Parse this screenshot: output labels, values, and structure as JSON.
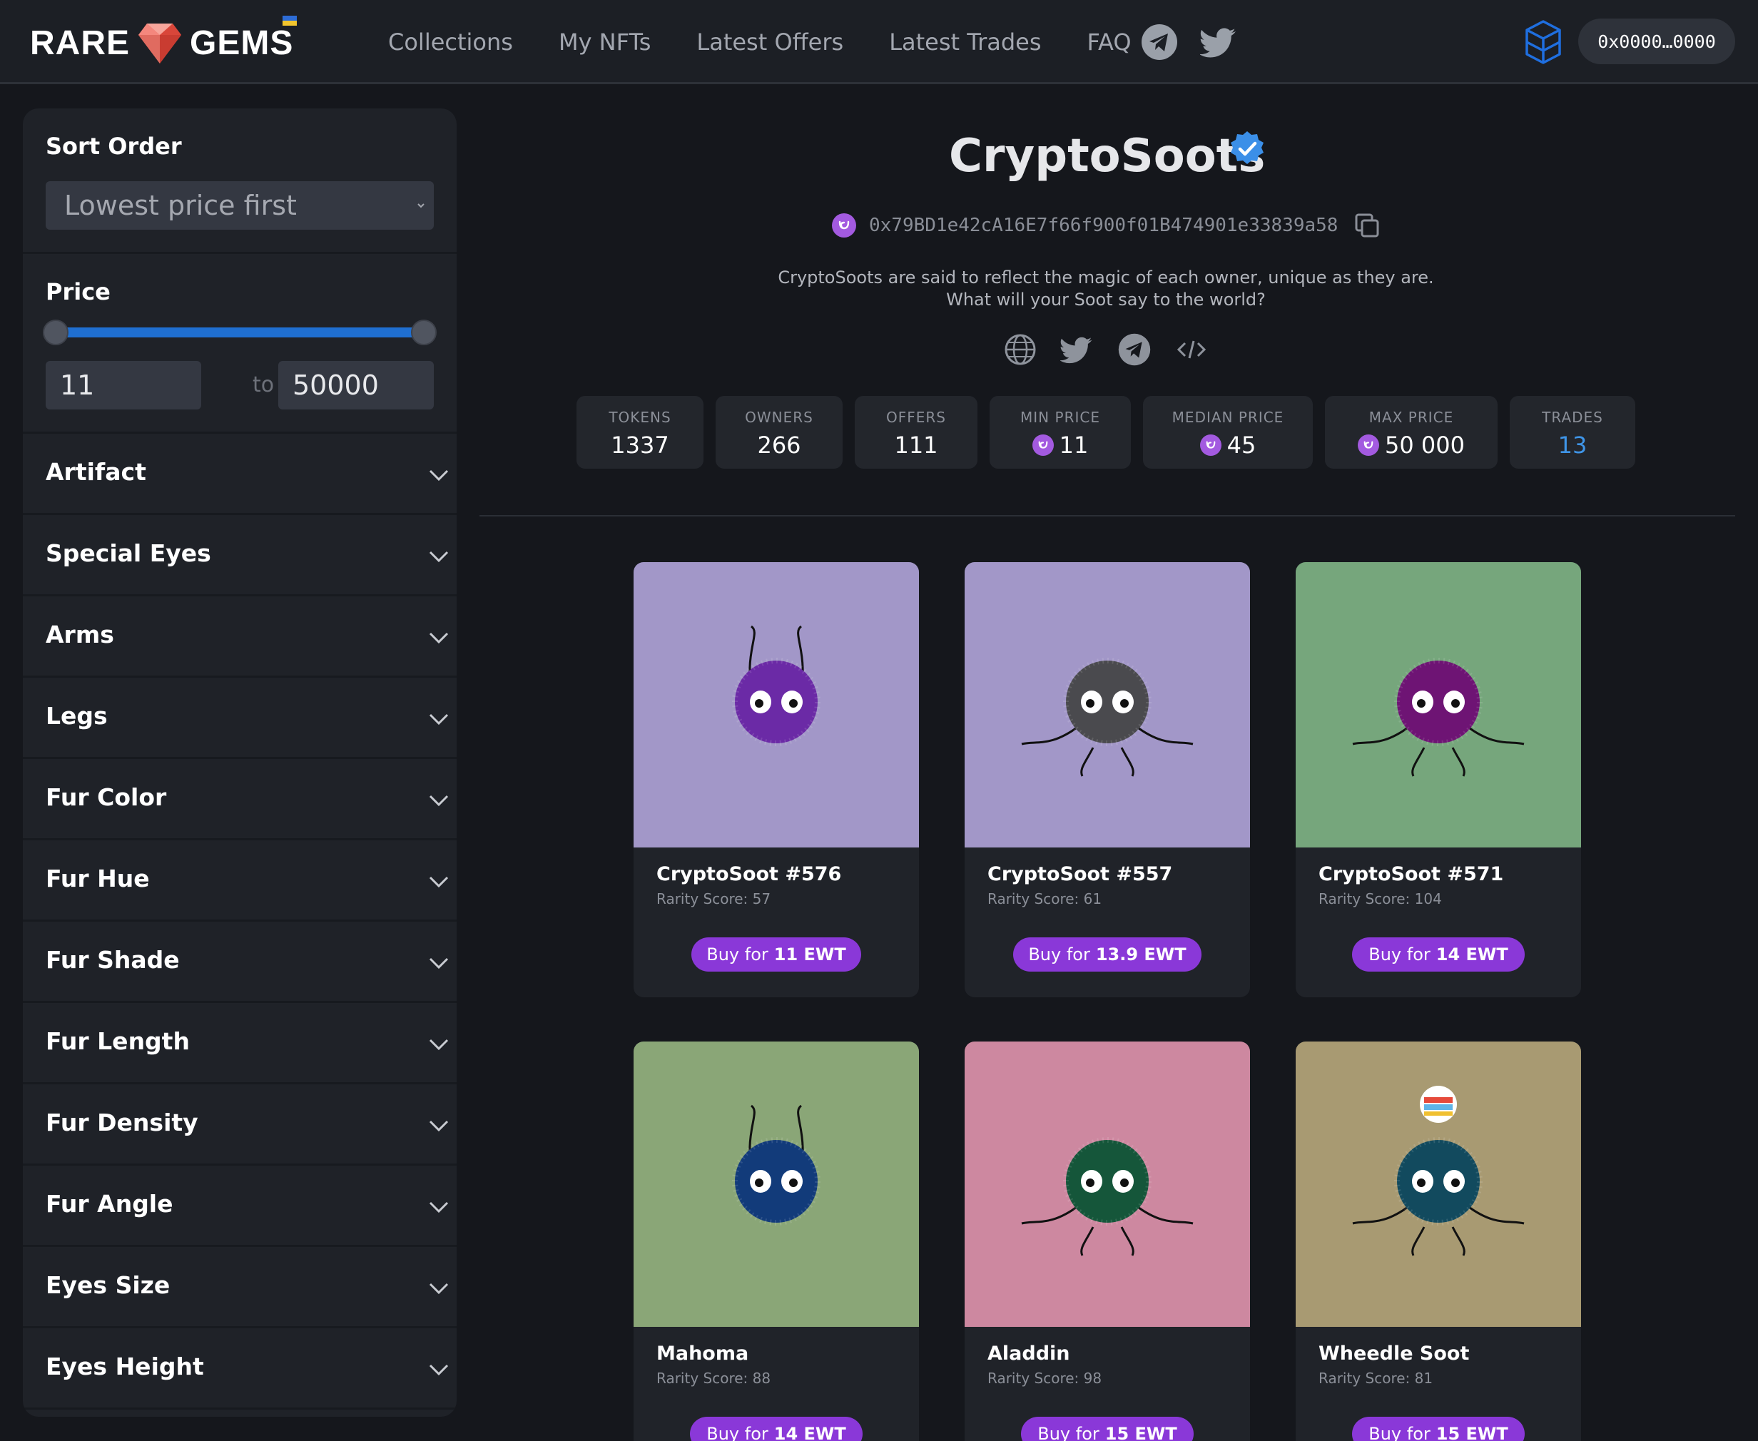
{
  "brand": {
    "left": "RARE",
    "right": "GEMS"
  },
  "nav": {
    "links": [
      "Collections",
      "My NFTs",
      "Latest Offers",
      "Latest Trades",
      "FAQ"
    ],
    "social_icons": [
      "telegram-icon",
      "twitter-icon"
    ],
    "wallet": "0x0000…0000"
  },
  "sidebar": {
    "sort_title": "Sort Order",
    "sort_value": "Lowest price first",
    "price_title": "Price",
    "price_min": "11",
    "price_max": "50000",
    "price_to": "to",
    "filters": [
      "Artifact",
      "Special Eyes",
      "Arms",
      "Legs",
      "Fur Color",
      "Fur Hue",
      "Fur Shade",
      "Fur Length",
      "Fur Density",
      "Fur Angle",
      "Eyes Size",
      "Eyes Height"
    ]
  },
  "collection": {
    "title": "CryptoSoots",
    "address": "0x79BD1e42cA16E7f66f900f01B474901e33839a58",
    "description_line1": "CryptoSoots are said to reflect the magic of each owner, unique as they are.",
    "description_line2": "What will your Soot say to the world?",
    "social_icons": [
      "globe-icon",
      "twitter-icon",
      "telegram-icon",
      "code-icon"
    ]
  },
  "stats": [
    {
      "key": "TOKENS",
      "value": "1337"
    },
    {
      "key": "OWNERS",
      "value": "266"
    },
    {
      "key": "OFFERS",
      "value": "111"
    },
    {
      "key": "MIN PRICE",
      "value": "11",
      "coin": true
    },
    {
      "key": "MEDIAN PRICE",
      "value": "45",
      "coin": true
    },
    {
      "key": "MAX PRICE",
      "value": "50 000",
      "coin": true
    },
    {
      "key": "TRADES",
      "value": "13",
      "link": true
    }
  ],
  "cards": [
    {
      "name": "CryptoSoot #576",
      "rarity": "Rarity Score: 57",
      "buy_prefix": "Buy for",
      "price": "11 EWT",
      "bg": "#a297c8",
      "fur": "#6b2aa6"
    },
    {
      "name": "CryptoSoot #557",
      "rarity": "Rarity Score: 61",
      "buy_prefix": "Buy for",
      "price": "13.9 EWT",
      "bg": "#a297c8",
      "fur": "#4a4a4e"
    },
    {
      "name": "CryptoSoot #571",
      "rarity": "Rarity Score: 104",
      "buy_prefix": "Buy for",
      "price": "14 EWT",
      "bg": "#76a67c",
      "fur": "#6e1474"
    },
    {
      "name": "Mahoma",
      "rarity": "Rarity Score: 88",
      "buy_prefix": "Buy for",
      "price": "14 EWT",
      "bg": "#8aa677",
      "fur": "#123b7a"
    },
    {
      "name": "Aladdin",
      "rarity": "Rarity Score: 98",
      "buy_prefix": "Buy for",
      "price": "15 EWT",
      "bg": "#cd88a0",
      "fur": "#15563a"
    },
    {
      "name": "Wheedle Soot",
      "rarity": "Rarity Score: 81",
      "buy_prefix": "Buy for",
      "price": "15 EWT",
      "bg": "#a89a72",
      "fur": "#124a5e"
    }
  ],
  "colors": {
    "accent": "#8a38d8",
    "link": "#3f95e8",
    "slider": "#1f6fd1",
    "verified": "#3b8fe8"
  }
}
